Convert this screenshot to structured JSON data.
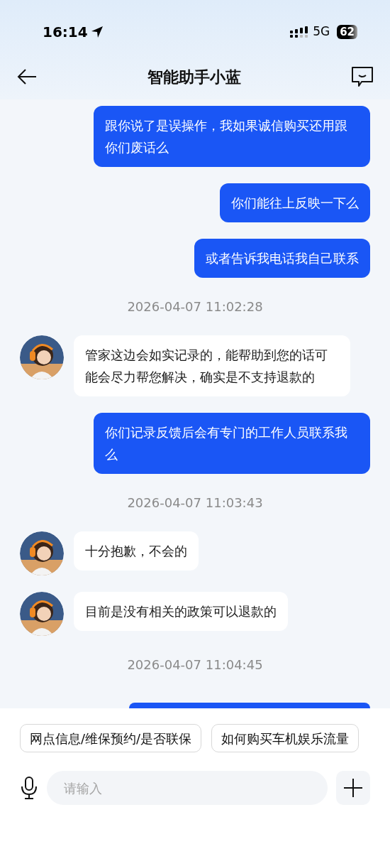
{
  "status_bar": {
    "time": "16:14",
    "network": "5G",
    "battery": "62"
  },
  "header": {
    "title": "智能助手小蓝"
  },
  "messages": [
    {
      "kind": "user",
      "text": "跟你说了是误操作，我如果诚信购买还用跟你们废话么"
    },
    {
      "kind": "user",
      "text": "你们能往上反映一下么"
    },
    {
      "kind": "user",
      "text": "或者告诉我电话我自己联系"
    },
    {
      "kind": "time",
      "text": "2026-04-07 11:02:28"
    },
    {
      "kind": "bot",
      "text": "管家这边会如实记录的，能帮助到您的话可能会尽力帮您解决，确实是不支持退款的"
    },
    {
      "kind": "user",
      "text": "你们记录反馈后会有专门的工作人员联系我么"
    },
    {
      "kind": "time",
      "text": "2026-04-07 11:03:43"
    },
    {
      "kind": "bot",
      "text": "十分抱歉，不会的"
    },
    {
      "kind": "bot",
      "text": "目前是没有相关的政策可以退款的"
    },
    {
      "kind": "time",
      "text": "2026-04-07 11:04:45"
    },
    {
      "kind": "user_partial"
    }
  ],
  "quick_replies": [
    "网点信息/维保预约/是否联保",
    "如何购买车机娱乐流量"
  ],
  "input": {
    "placeholder": "请输入"
  }
}
